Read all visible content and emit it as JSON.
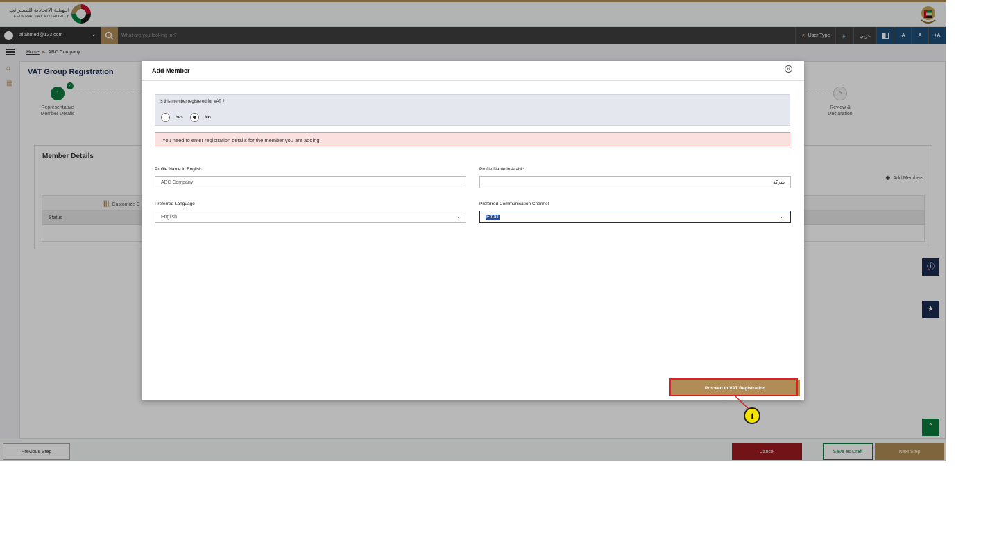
{
  "header": {
    "logo_ar": "الـهيئـة الاتحادية للـضـرائب",
    "logo_en": "FEDERAL TAX AUTHORITY"
  },
  "searchbar": {
    "user_email": "aliahmed@123.com",
    "search_placeholder": "What are you looking for?",
    "user_type": "User Type",
    "lang": "عربي",
    "font_minus": "-A",
    "font_normal": "A",
    "font_plus": "+A"
  },
  "breadcrumb": {
    "home": "Home",
    "current": "ABC Company"
  },
  "page": {
    "title": "VAT Group Registration",
    "steps": [
      {
        "number": "1",
        "label_line1": "Representative",
        "label_line2": "Member Details",
        "status": "complete"
      },
      {
        "number": "5",
        "label_line1": "Review &",
        "label_line2": "Declaration",
        "status": "pending"
      }
    ]
  },
  "member_details": {
    "title": "Member Details",
    "add_members": "Add Members",
    "customize": "Customize C",
    "status_col": "Status"
  },
  "footer": {
    "previous": "Previous Step",
    "cancel": "Cancel",
    "save_draft": "Save as Draft",
    "next": "Next Step"
  },
  "modal": {
    "title": "Add Member",
    "vat_question": "Is this member registered for VAT ?",
    "yes": "Yes",
    "no": "No",
    "selected": "No",
    "alert": "You need to enter registration details for the member you are adding",
    "profile_en_label": "Profile Name in English",
    "profile_en_value": "ABC Company",
    "profile_ar_label": "Profile Name in Arabic",
    "profile_ar_value": "شركة",
    "pref_lang_label": "Preferred Language",
    "pref_lang_value": "English",
    "pref_comm_label": "Preferred Communication Channel",
    "pref_comm_value": "Email",
    "proceed": "Proceed to VAT Registration"
  },
  "annotation": {
    "callout_number": "1",
    "highlight_color": "#e02020",
    "callout_color": "#f5e300"
  },
  "colors": {
    "brand_gold": "#b08d57",
    "navy": "#1d2b4f",
    "green": "#0d7a3c",
    "danger": "#9e1b22"
  }
}
